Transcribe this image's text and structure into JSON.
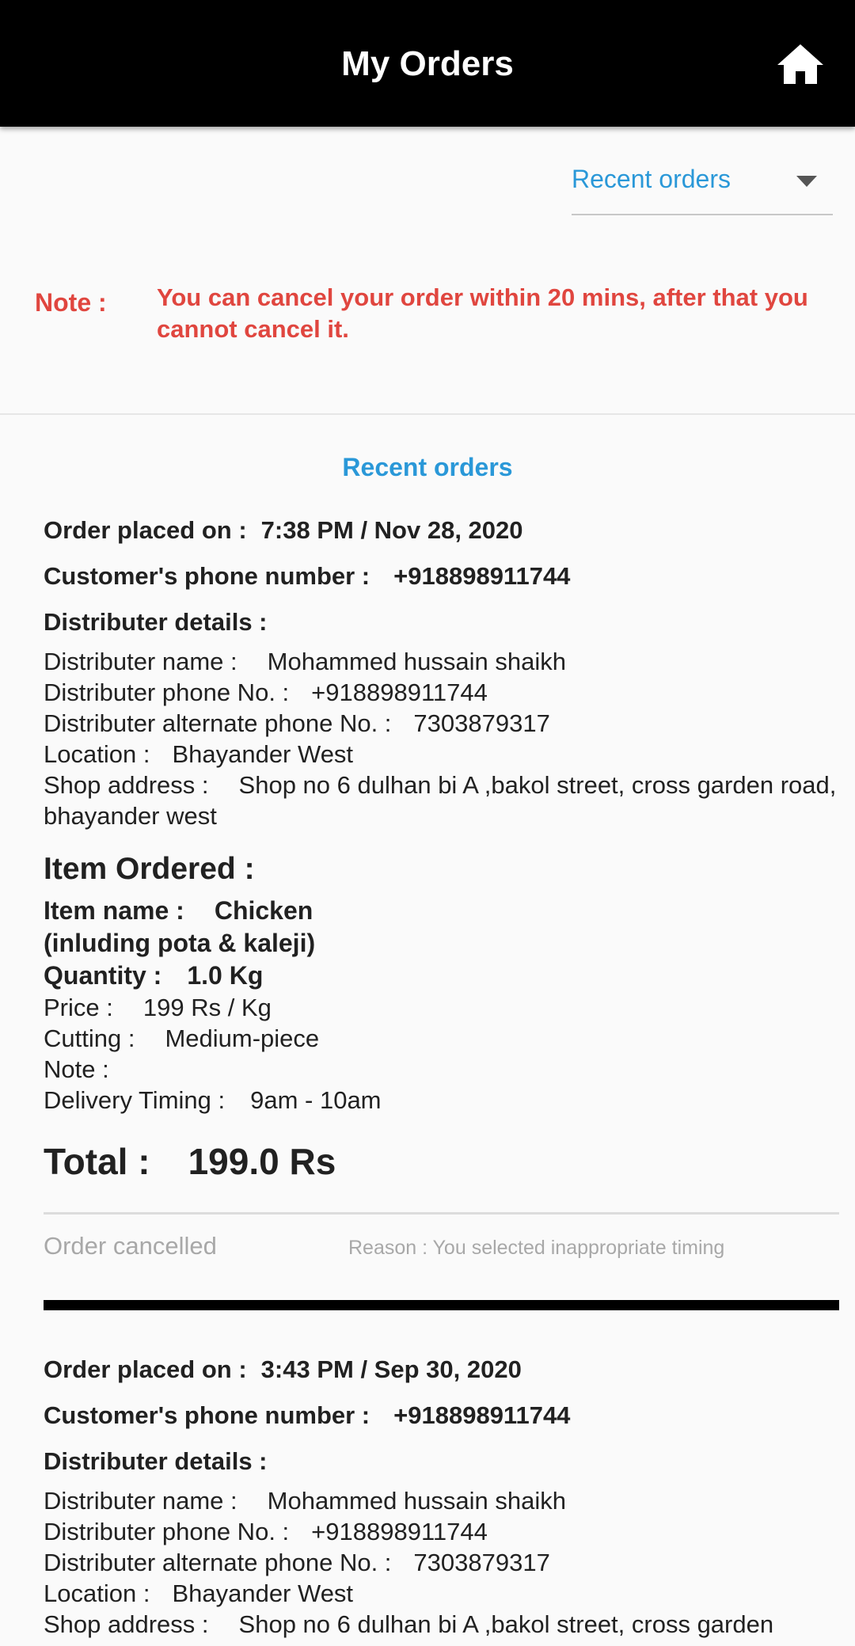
{
  "appbar": {
    "title": "My Orders",
    "home_icon": "home-icon"
  },
  "filter": {
    "selected": "Recent orders"
  },
  "note": {
    "label": "Note :",
    "text": "You can cancel your order within 20 mins, after that you cannot cancel it."
  },
  "section_title": "Recent orders",
  "labels": {
    "order_placed": "Order placed on :",
    "customer_phone": "Customer's phone number :",
    "distributer_details": "Distributer details :",
    "distributer_name": "Distributer name :",
    "distributer_phone": "Distributer phone No. :",
    "distributer_alt_phone": "Distributer alternate phone No. :",
    "location": "Location :",
    "shop_address": "Shop address :",
    "item_ordered": "Item Ordered :",
    "item_name": "Item name :",
    "quantity": "Quantity :",
    "price": "Price :",
    "cutting": "Cutting :",
    "note": "Note :",
    "delivery_timing": "Delivery Timing :",
    "total": "Total :"
  },
  "orders": [
    {
      "placed_on": "7:38 PM / Nov 28, 2020",
      "customer_phone": "+918898911744",
      "distributer_name": "Mohammed hussain shaikh",
      "distributer_phone": "+918898911744",
      "distributer_alt_phone": "7303879317",
      "location": "Bhayander West",
      "shop_address": "Shop no 6 dulhan bi A ,bakol street, cross garden road, bhayander west",
      "item_name": "Chicken (inluding pota & kaleji)",
      "quantity": "1.0  Kg",
      "price": "199 Rs / Kg",
      "cutting": "Medium-piece",
      "note": "",
      "delivery_timing": "9am  -  10am",
      "total": "199.0 Rs",
      "status": "Order cancelled",
      "reason": "Reason : You selected inappropriate timing"
    },
    {
      "placed_on": "3:43 PM / Sep 30, 2020",
      "customer_phone": "+918898911744",
      "distributer_name": "Mohammed hussain shaikh",
      "distributer_phone": "+918898911744",
      "distributer_alt_phone": "7303879317",
      "location": "Bhayander West",
      "shop_address": "Shop no 6 dulhan bi A ,bakol street, cross garden"
    }
  ]
}
